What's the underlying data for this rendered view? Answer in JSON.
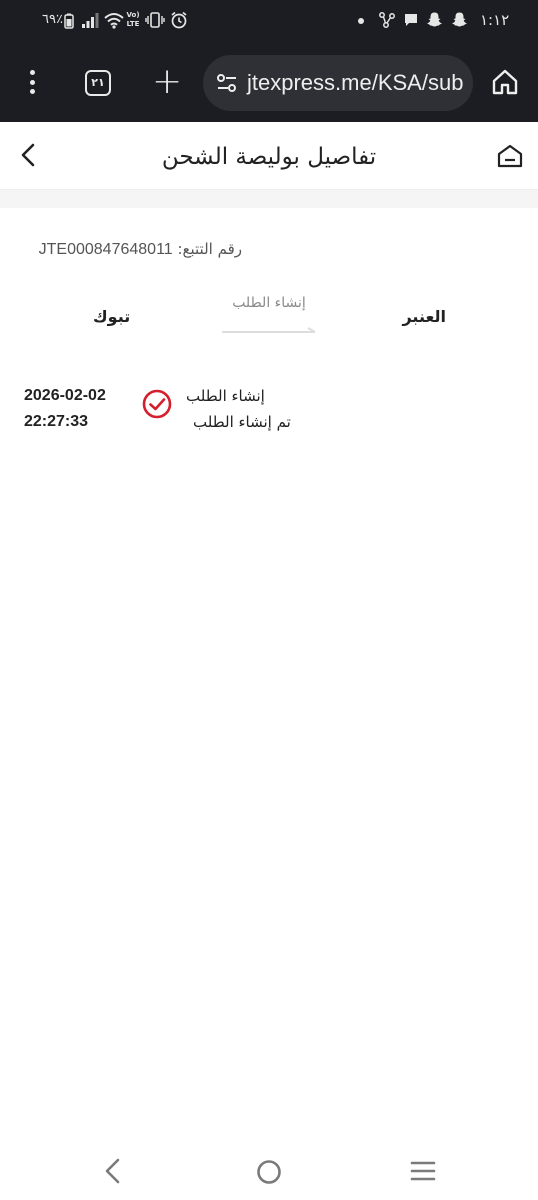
{
  "status_bar": {
    "time": "١:١٢",
    "battery": "٦٩٪",
    "network_label": "Vo) LTE"
  },
  "browser": {
    "tab_count": "٢١",
    "url": "jtexpress.me/KSA/sub",
    "icons": [
      "more-vert-icon",
      "tab-switcher-icon",
      "plus-icon",
      "site-settings-icon",
      "home-icon"
    ]
  },
  "page": {
    "title": "تفاصيل بوليصة الشحن",
    "tracking_label": "رقم التتبع:",
    "tracking_number": "JTE000847648011",
    "route": {
      "from": "العنبر",
      "to": "تبوك",
      "status": "إنشاء الطلب"
    },
    "events": [
      {
        "date": "2026-02-02",
        "time": "22:27:33",
        "title": "إنشاء الطلب",
        "description": "تم إنشاء الطلب"
      }
    ]
  },
  "colors": {
    "chrome_bg": "#1c1d22",
    "urlbar_bg": "#2f3036",
    "accent_red": "#d3202c"
  }
}
